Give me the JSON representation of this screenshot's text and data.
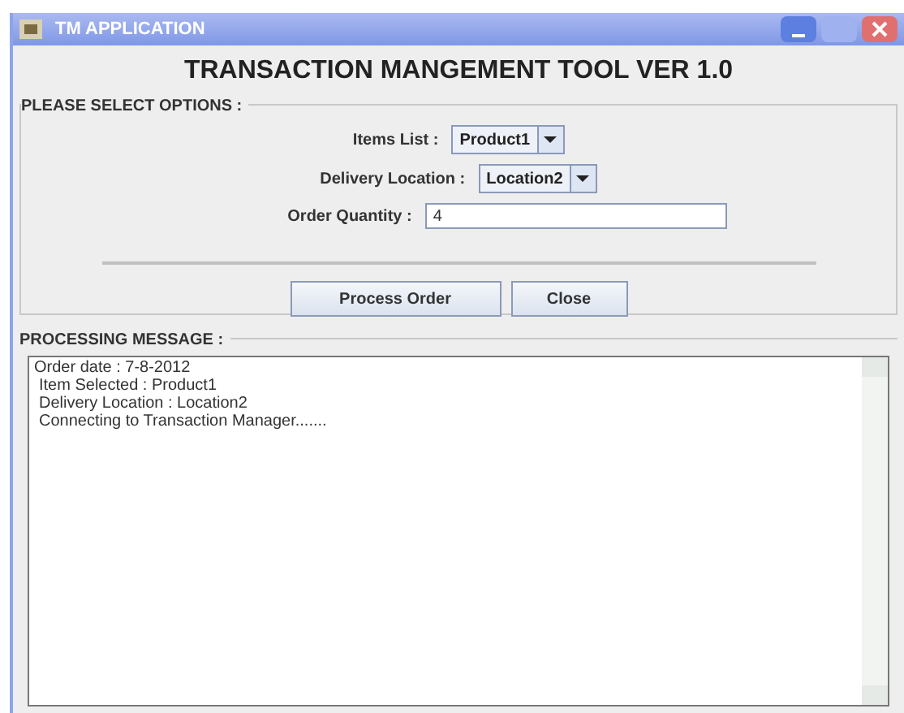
{
  "window": {
    "title": "TM APPLICATION"
  },
  "heading": "TRANSACTION MANGEMENT TOOL VER 1.0",
  "options_group": {
    "title": "PLEASE SELECT OPTIONS :",
    "fields": [
      {
        "kind": "dropdown",
        "label": "Items List :",
        "value": "Product1"
      },
      {
        "kind": "dropdown",
        "label": "Delivery Location :",
        "value": "Location2"
      },
      {
        "kind": "text",
        "label": "Order Quantity :",
        "value": "4"
      }
    ]
  },
  "buttons": [
    "Process Order",
    "Close"
  ],
  "message_group": {
    "title": "PROCESSING MESSAGE :",
    "lines": [
      "Order date : 7-8-2012",
      "Item Selected : Product1",
      "Delivery Location : Location2",
      "Connecting to Transaction Manager......."
    ]
  }
}
